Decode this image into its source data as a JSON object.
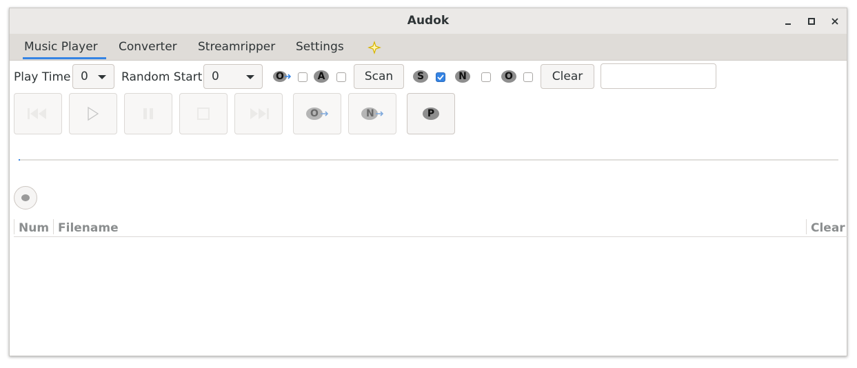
{
  "window": {
    "title": "Audok"
  },
  "tabs": [
    {
      "label": "Music Player"
    },
    {
      "label": "Converter"
    },
    {
      "label": "Streamripper"
    },
    {
      "label": "Settings"
    }
  ],
  "toolbar": {
    "play_time_label": "Play Time",
    "play_time_value": "0",
    "random_start_label": "Random Start",
    "random_start_value": "0",
    "badge_o_arrow": "O",
    "badge_a": "A",
    "scan_label": "Scan",
    "badge_s": "S",
    "badge_n": "N",
    "badge_o": "O",
    "clear_label": "Clear",
    "search_value": ""
  },
  "checkboxes": {
    "o_arrow": false,
    "a": false,
    "s": true,
    "n": false,
    "o": false
  },
  "player": {
    "next_o_badge": "O",
    "next_n_badge": "N",
    "p_badge": "P",
    "progress": 0.0
  },
  "table": {
    "columns": [
      "Num",
      "Filename",
      "Clear"
    ],
    "rows": []
  },
  "colors": {
    "accent": "#3584e4",
    "badge_dark": "#8e8e8e",
    "badge_light": "#b5b5b5"
  }
}
